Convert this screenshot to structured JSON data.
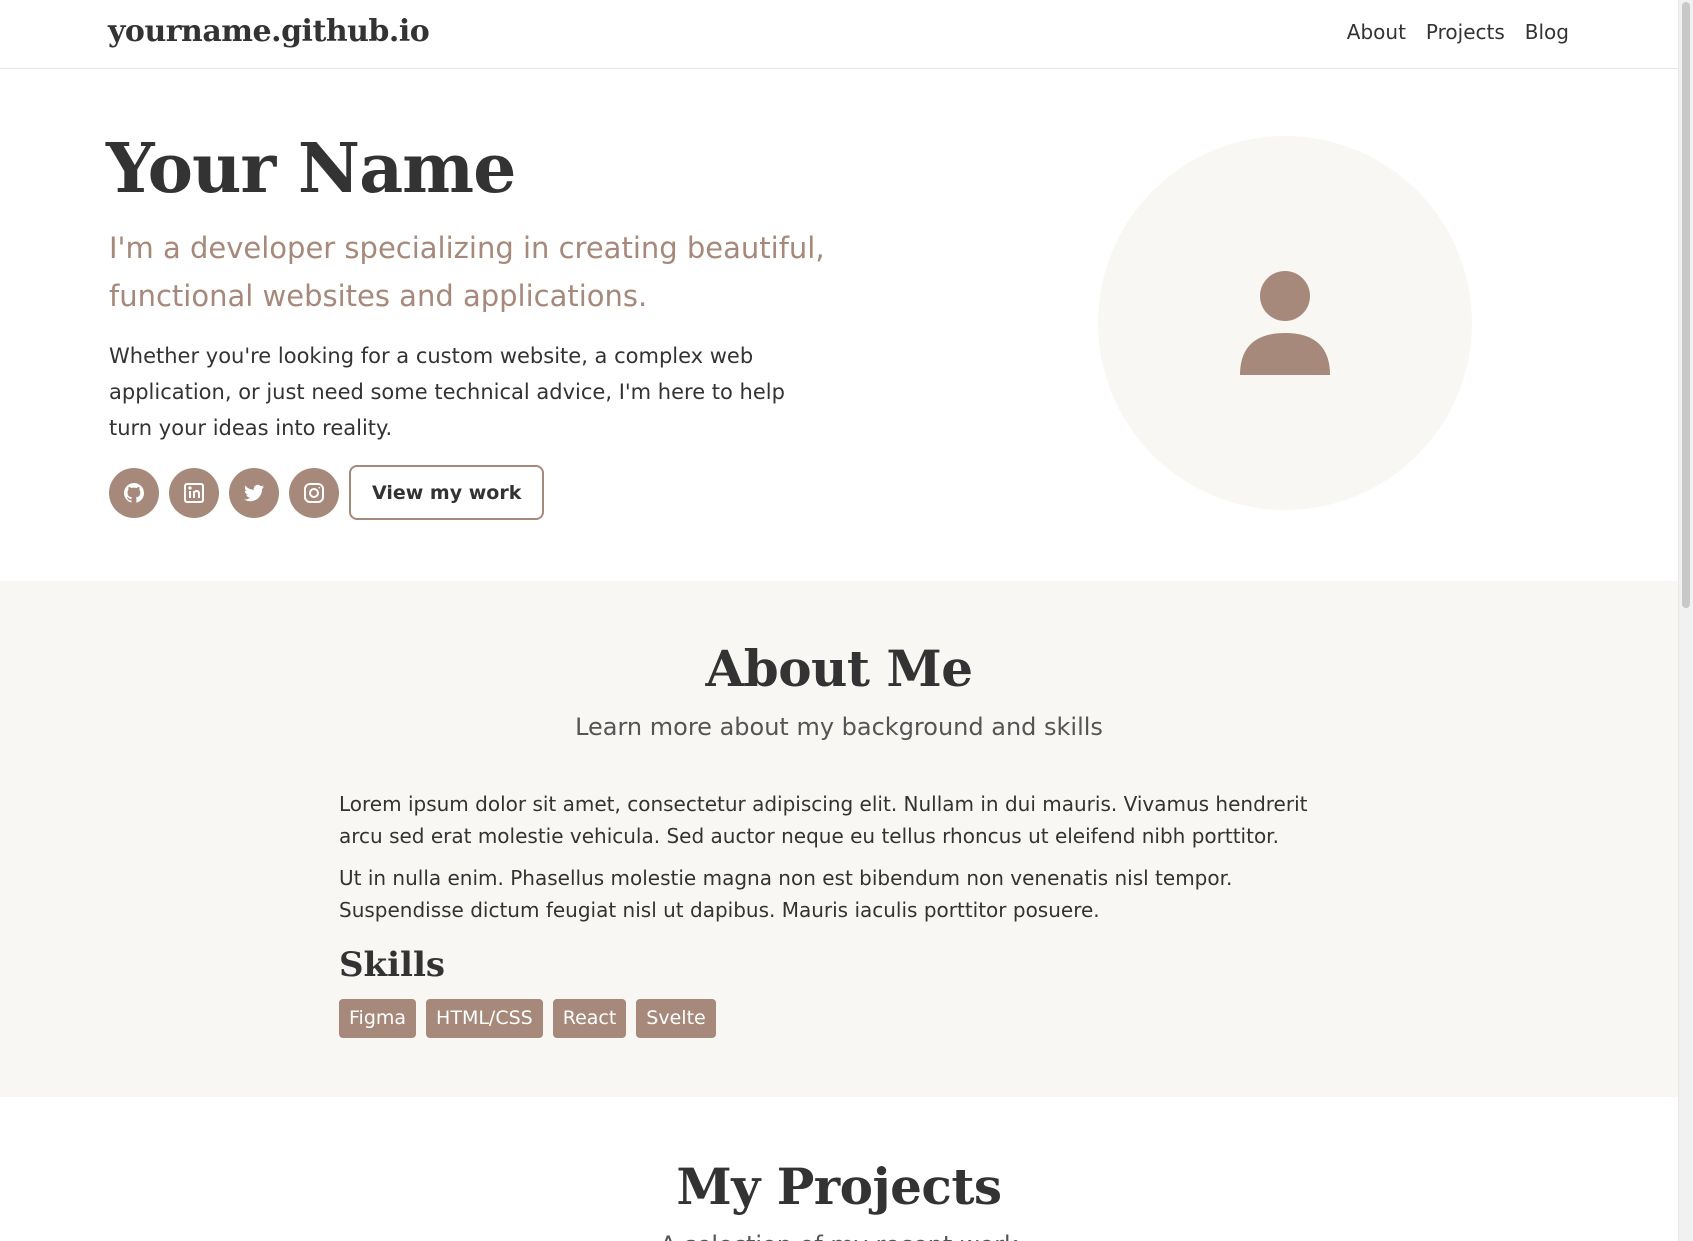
{
  "header": {
    "logo": "yourname.github.io",
    "nav": [
      "About",
      "Projects",
      "Blog"
    ]
  },
  "hero": {
    "title": "Your Name",
    "subtitle": "I'm a developer specializing in creating beautiful, functional websites and applications.",
    "text": "Whether you're looking for a custom website, a complex web application, or just need some technical advice, I'm here to help turn your ideas into reality.",
    "social_icons": [
      "github-icon",
      "linkedin-icon",
      "twitter-icon",
      "instagram-icon"
    ],
    "cta_label": "View my work",
    "avatar_icon": "user-icon"
  },
  "about": {
    "title": "About Me",
    "subtitle": "Learn more about my background and skills",
    "paragraphs": [
      "Lorem ipsum dolor sit amet, consectetur adipiscing elit. Nullam in dui mauris. Vivamus hendrerit arcu sed erat molestie vehicula. Sed auctor neque eu tellus rhoncus ut eleifend nibh porttitor.",
      "Ut in nulla enim. Phasellus molestie magna non est bibendum non venenatis nisl tempor. Suspendisse dictum feugiat nisl ut dapibus. Mauris iaculis porttitor posuere."
    ],
    "skills_title": "Skills",
    "skills": [
      "Figma",
      "HTML/CSS",
      "React",
      "Svelte"
    ]
  },
  "projects": {
    "title": "My Projects",
    "subtitle": "A selection of my recent work"
  },
  "colors": {
    "accent": "#a6897a",
    "section_bg": "#f8f7f4",
    "text": "#333333"
  }
}
